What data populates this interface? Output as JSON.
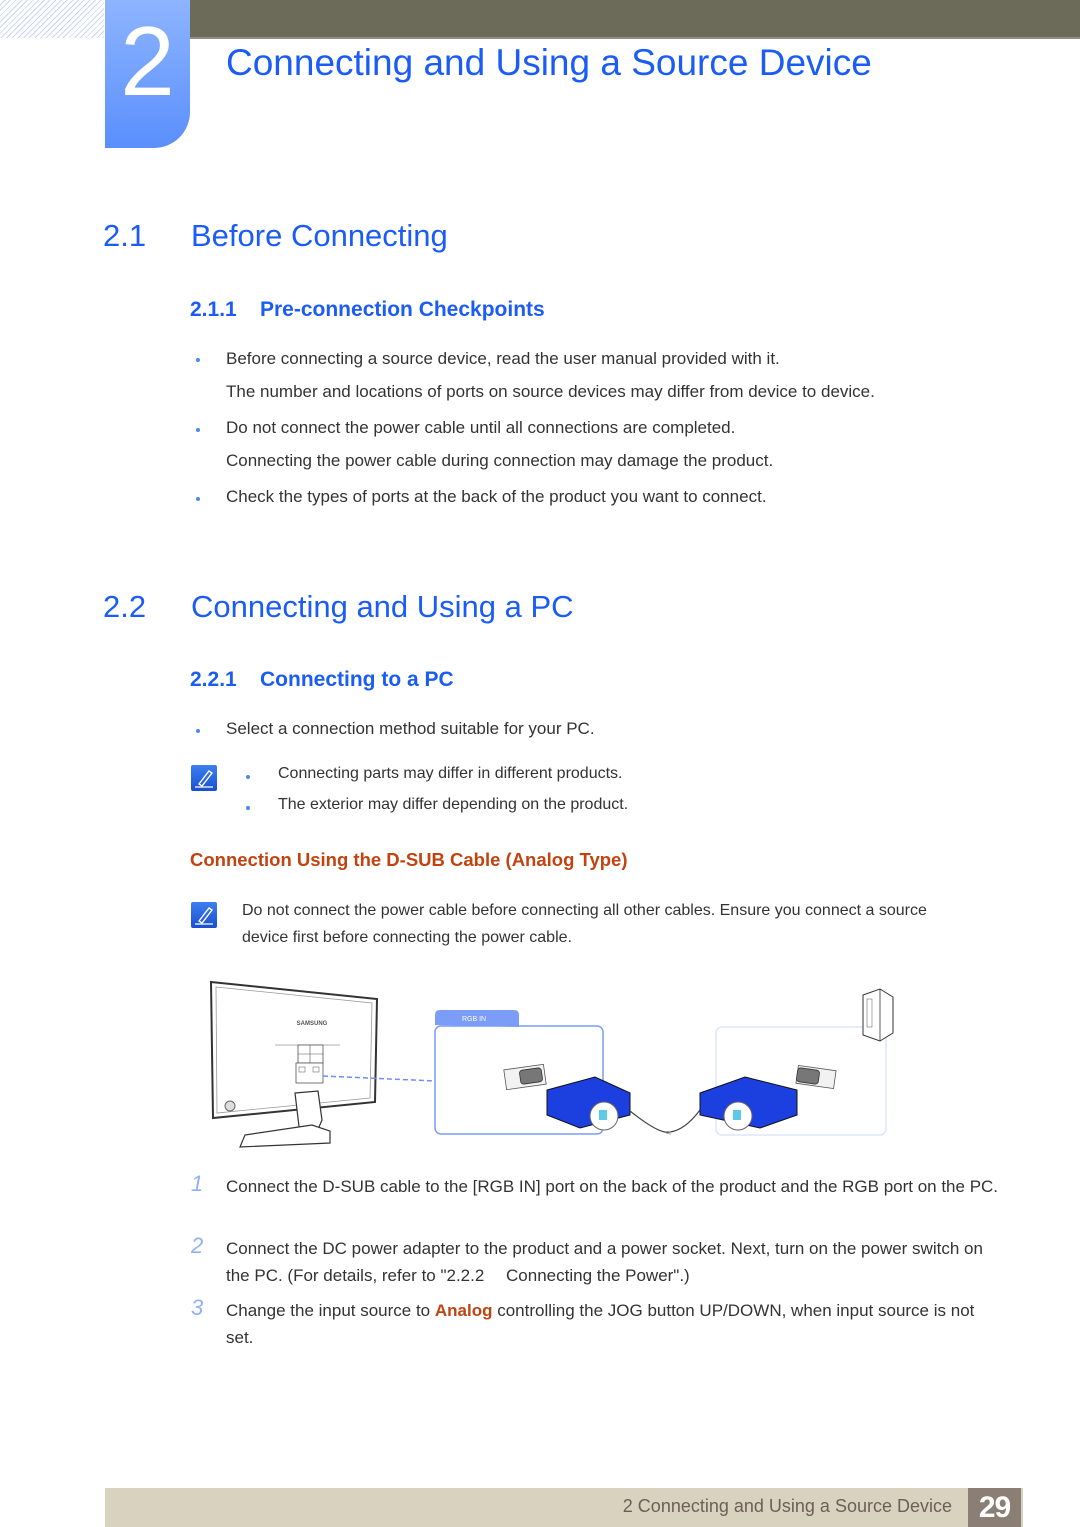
{
  "chapter": {
    "number": "2",
    "title": "Connecting and Using a Source Device"
  },
  "section_2_1": {
    "number": "2.1",
    "title": "Before Connecting",
    "subsection": {
      "number": "2.1.1",
      "title": "Pre-connection Checkpoints",
      "items": [
        {
          "bullet": "Before connecting a source device, read the user manual provided with it.",
          "detail": "The number and locations of ports on source devices may differ from device to device."
        },
        {
          "bullet": "Do not connect the power cable until all connections are completed.",
          "detail": "Connecting the power cable during connection may damage the product."
        },
        {
          "bullet": "Check the types of ports at the back of the product you want to connect.",
          "detail": ""
        }
      ]
    }
  },
  "section_2_2": {
    "number": "2.2",
    "title": "Connecting and Using a PC",
    "subsection": {
      "number": "2.2.1",
      "title": "Connecting to a PC",
      "bullet": "Select a connection method suitable for your PC.",
      "notes": [
        "Connecting parts may differ in different products.",
        "The exterior may differ depending on the product."
      ],
      "dsub": {
        "title": "Connection Using the D-SUB Cable (Analog Type)",
        "note_line1": "Do not connect the power cable before connecting all other cables. Ensure you connect a source",
        "note_line2": "device first before connecting the power cable.",
        "diagram": {
          "port_label": "RGB IN",
          "brand_label": "SAMSUNG",
          "monitor_icon": "monitor-back-icon",
          "pc_icon": "pc-tower-icon",
          "connector_icon": "dsub-connector-icon"
        },
        "steps": [
          {
            "num": "1",
            "text": "Connect the D-SUB cable to the [RGB IN] port on the back of the product and the RGB port on the PC."
          },
          {
            "num": "2",
            "text": "Connect the DC power adapter to the product and a power socket. Next, turn on the power switch on the PC. (For details, refer to \"2.2.2  Connecting the Power\".)"
          },
          {
            "num": "3",
            "text_before": "Change the input source to ",
            "highlight": "Analog",
            "text_after": " controlling the JOG button UP/DOWN, when input source is not set."
          }
        ]
      }
    }
  },
  "footer": {
    "chapter_title": "2 Connecting and Using a Source Device",
    "page_number": "29"
  },
  "colors": {
    "heading_blue": "#1a5cf5",
    "accent_orange": "#c2430f",
    "top_bar": "#6c6a58",
    "footer_band": "#d9d2bf",
    "page_box": "#8b7e74"
  }
}
